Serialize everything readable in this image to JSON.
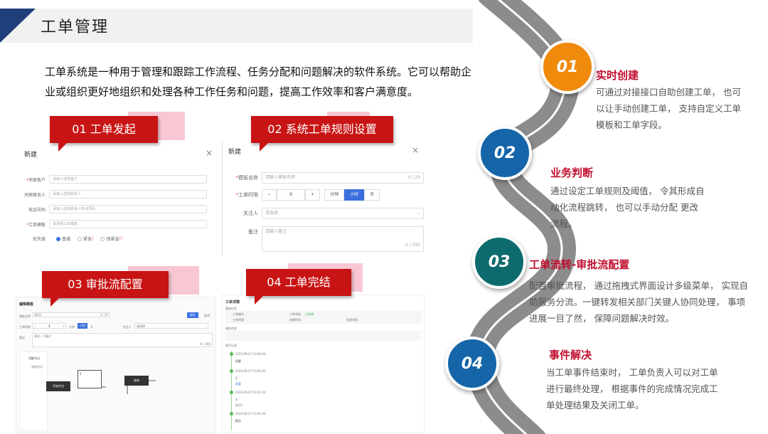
{
  "header": {
    "title": "工单管理"
  },
  "intro": "工单系统是一种用于管理和跟踪工作流程、任务分配和问题解决的软件系统。它可以帮助企业或组织更好地组织和处理各种工作任务和问题，提高工作效率和客户满意度。",
  "callouts": [
    "01 工单发起",
    "02 系统工单规则设置",
    "03 审批流配置",
    "04 工单完结"
  ],
  "panel1": {
    "title": "新建",
    "close": "×",
    "rows": [
      {
        "label": "关联客户",
        "required": "*",
        "placeholder": "请输入选择客户"
      },
      {
        "label": "关联联系人",
        "required": "",
        "placeholder": "请输入选择联系人"
      },
      {
        "label": "电话号码",
        "required": "",
        "placeholder": "请输入选择联系人电话号码"
      },
      {
        "label": "工单模板",
        "required": "*",
        "placeholder": "请选择工单模板"
      }
    ],
    "priority_label": "优先级",
    "priority_options": [
      "普通",
      "紧急",
      "很紧急"
    ],
    "priority_marks": [
      "!",
      "!!"
    ]
  },
  "panel2": {
    "title": "新建",
    "close": "×",
    "name_label": "模板名称",
    "name_placeholder": "请输入模板名称",
    "name_count": "0 / 20",
    "time_label": "工单时限",
    "stepper_minus": "−",
    "stepper_value": "0",
    "stepper_plus": "+",
    "units": [
      "分钟",
      "小时",
      "天"
    ],
    "watcher_label": "关注人",
    "watcher_placeholder": "请选择",
    "note_label": "备注",
    "note_placeholder": "请输入备注",
    "note_count": "0 / 200"
  },
  "panel3": {
    "title": "编辑模板",
    "name_label": "模板名称",
    "name_value": "测试1",
    "name_count": "3 / 20",
    "btn_save": "保存",
    "btn_cancel": "取消",
    "time_label": "工单时限",
    "stepper_minus": "−",
    "stepper_value": "4",
    "stepper_plus": "+",
    "units": [
      "分钟",
      "小时",
      "天"
    ],
    "watcher_label": "关注人",
    "watcher_placeholder": "请选择",
    "note_label": "备注",
    "note_value": "测试一下备注",
    "note_count": "6 / 200",
    "flow_nodes_title": "功能节点",
    "flow_node_item": "流程节点",
    "node_start": "开始节点",
    "node_mid": "1",
    "node_end": "结束"
  },
  "panel4": {
    "title": "工单详情",
    "section_basic": "基础信息",
    "section_service": "服务信息",
    "section_records": "操作记录",
    "fields": [
      "工单编号",
      "工单状态",
      "已完成",
      "工单时限",
      "创建时间",
      "处理时限"
    ],
    "records": [
      "2023-09-07 10:00:40",
      "同意",
      "2023-09-07 10:01:00",
      "1",
      "同意",
      "2023-09-07 10:01:20",
      "1",
      "测试1",
      "2023-09-07 10:01:40",
      "提交"
    ]
  },
  "steps": [
    {
      "num": "01",
      "title": "实时创建",
      "desc": [
        "可通过对接接口自助创建工单， 也可",
        "以让手动创建工单， 支持自定义工单",
        "模板和工单字段。"
      ]
    },
    {
      "num": "02",
      "title": "业务判断",
      "desc": [
        "通过设定工单规则及阈值， 令其形成自",
        "动化流程跳转， 也可以手动分配 更改",
        "流程。"
      ]
    },
    {
      "num": "03",
      "title": "工单流转-审批流配置",
      "desc": [
        "配置审批流程， 通过拖拽式界面设计多级菜单， 实现自",
        "助服务分流。一键转发相关部门关键人协同处理， 事项",
        "进展一目了然， 保障问题解决时效。"
      ]
    },
    {
      "num": "04",
      "title": "事件解决",
      "desc": [
        "当工单事件结束时， 工单负责人可以对工单",
        "进行最终处理， 根据事件的完成情况完成工",
        "单处理结果及关闭工单。"
      ]
    }
  ],
  "colors": {
    "orange": "#f08a0c",
    "blue": "#1565a8",
    "teal": "#0d6b6e",
    "red": "#c81414",
    "title_red": "#c00f2e",
    "road": "#8c8c8c"
  },
  "icons": [
    "close-icon",
    "chevron-down-icon",
    "radio-icon"
  ]
}
